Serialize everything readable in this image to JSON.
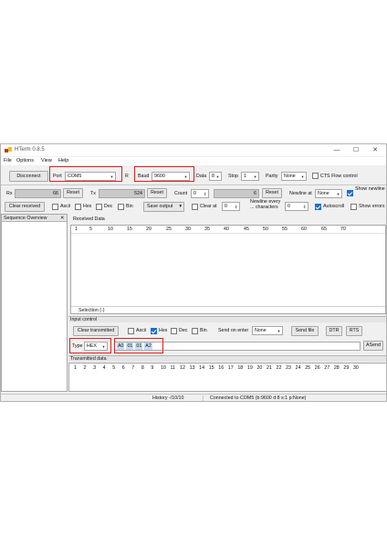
{
  "window": {
    "title": "HTerm 0.8.5",
    "min": "—",
    "max": "☐",
    "close": "✕"
  },
  "menu": [
    "File",
    "Options",
    "View",
    "Help"
  ],
  "connection": {
    "disconnect_label": "Disconnect",
    "port_label": "Port",
    "port_value": "COM5",
    "r_label": "R",
    "baud_label": "Baud",
    "baud_value": "9600",
    "data_label": "Data",
    "data_value": "8",
    "stop_label": "Stop",
    "stop_value": "1",
    "parity_label": "Parity",
    "parity_value": "None",
    "cts_label": "CTS Flow control"
  },
  "counters": {
    "rx_label": "Rx",
    "rx_value": "66",
    "rx_reset": "Reset",
    "tx_label": "Tx",
    "tx_value": "524",
    "tx_reset": "Reset",
    "count_label": "Count",
    "count_value": "0",
    "count_field": "6",
    "count_reset": "Reset",
    "newline_at_label": "Newline at",
    "newline_at_value": "None",
    "show_newline_label": "Show newline"
  },
  "rx_options": {
    "clear_received": "Clear received",
    "ascii": "Ascii",
    "hex": "Hex",
    "dec": "Dec",
    "bin": "Bin",
    "save_output": "Save output",
    "clear_at_label": "Clear at",
    "clear_at_value": "0",
    "newline_every_label": "Newline every",
    "characters_label": "... characters",
    "newline_every_value": "0",
    "autoscroll": "Autoscroll",
    "show_errors": "Show errors"
  },
  "sequence_overview": {
    "title": "Sequence Overview",
    "close": "✕"
  },
  "received": {
    "title": "Received Data",
    "ruler": [
      "1",
      "5",
      "10",
      "15",
      "20",
      "25",
      "30",
      "35",
      "40",
      "45",
      "50",
      "55",
      "60",
      "65",
      "70"
    ],
    "selection": "Selection (-)"
  },
  "input_control": {
    "title": "Input control",
    "clear_transmitted": "Clear transmitted",
    "ascii": "Ascii",
    "hex": "Hex",
    "dec": "Dec",
    "bin": "Bin",
    "send_on_enter_label": "Send on enter",
    "send_on_enter_value": "None",
    "send_file": "Send file",
    "dtr": "DTR",
    "rts": "RTS",
    "type_label": "Type",
    "type_value": "HEX",
    "input_bytes": [
      "A0",
      "01",
      "01",
      "A2"
    ],
    "asend": "ASend"
  },
  "transmitted": {
    "title": "Transmitted data",
    "ruler": [
      "1",
      "2",
      "3",
      "4",
      "5",
      "6",
      "7",
      "8",
      "9",
      "10",
      "11",
      "12",
      "13",
      "14",
      "15",
      "16",
      "17",
      "18",
      "19",
      "20",
      "21",
      "22",
      "23",
      "24",
      "25",
      "26",
      "27",
      "28",
      "29",
      "30"
    ]
  },
  "status": {
    "history": "History -/10/10",
    "connection": "Connected to COM5 (b:9600 d:8 s:1 p:None)"
  },
  "colors": {
    "highlight": "#e02020",
    "selected_hex": "#c7dcf6",
    "accent": "#1a6fd1"
  }
}
